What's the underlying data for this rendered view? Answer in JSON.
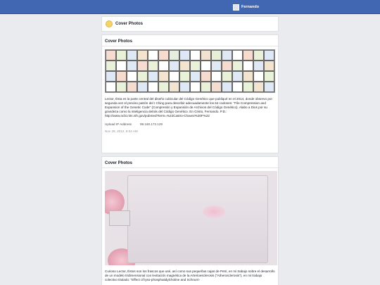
{
  "header": {
    "user_name": "Fernando"
  },
  "page": {
    "title": "Cover Photos"
  },
  "posts": [
    {
      "title": "Cover Photos",
      "description": "Lector, Ésta es la parte central del diseño cubicular del Código Genético que publiqué en el 2014, donde observo por segunda vez el preciso patrón del I Ching para describir adecuadamente los 64 codones: \"File Compression and Expansion of the Genetic Code\" (Compresión y Expansión de Archivos del Código Genético). Alabo a Dios por su grandeza como la inteligencia detrás del Código Genético. En Cristo, Fernando. P.D.: http://www.ncbi.nlm.nih.gov/pubmed?term=%22Castro-Chavez%20F%22",
      "upload_ip_label": "Upload IP Address",
      "upload_ip": "99.160.173.129",
      "date": "Nov 29, 2012, 8:04 AM"
    },
    {
      "title": "Cover Photos",
      "description": "Curioso Lector, Éstos son los frascos que usé, así como sus pequeñas cajas de Petri, en mi trabajo sobre el desarrollo de un modelo tridimensional con levitación magnética de la Arterioesclerosis (\"Atherosclerosis\"), en mi trabajo colectivo titulado: \"Effect of lyso-phosphatidylcholine and Schnurri-"
    }
  ]
}
